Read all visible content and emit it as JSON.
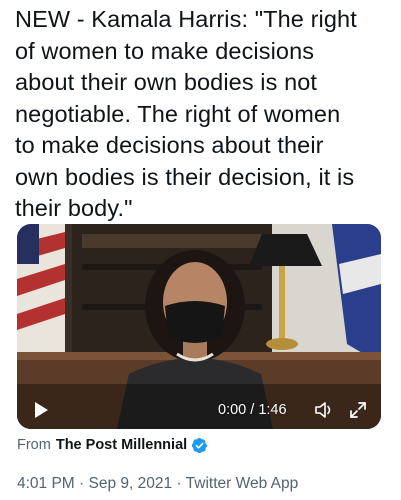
{
  "tweet": {
    "text": "NEW - Kamala Harris: \"The right\nof women to make decisions\nabout their own bodies is not\nnegotiable. The right of women\nto make decisions about their\nown bodies is their decision, it is\ntheir body.\""
  },
  "video": {
    "current_time": "0:00",
    "separator": "/",
    "duration": "1:46",
    "progress": 0,
    "icons": [
      "play-icon",
      "volume-icon",
      "expand-icon"
    ]
  },
  "source": {
    "prefix": "From",
    "name": "The Post Millennial",
    "verified_color": "#1d9bf0"
  },
  "meta": {
    "time": "4:01 PM",
    "dot": "·",
    "date": "Sep 9, 2021",
    "client": "Twitter Web App"
  },
  "colors": {
    "text": "#0f1419",
    "secondary": "#536471",
    "accent": "#1d9bf0"
  }
}
